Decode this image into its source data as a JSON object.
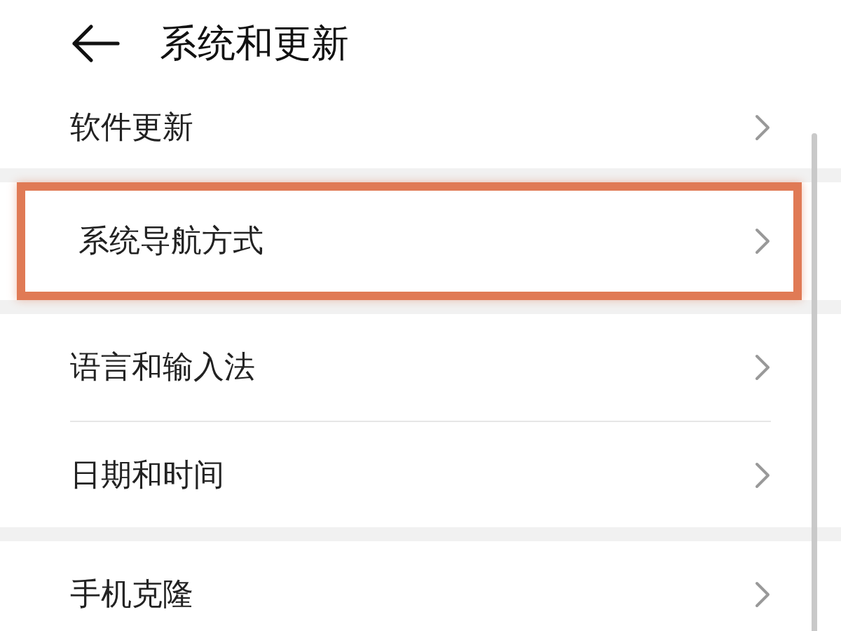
{
  "header": {
    "title": "系统和更新"
  },
  "groups": [
    {
      "items": [
        {
          "label": "软件更新",
          "highlighted": false
        }
      ]
    },
    {
      "items": [
        {
          "label": "系统导航方式",
          "highlighted": true
        }
      ]
    },
    {
      "items": [
        {
          "label": "语言和输入法",
          "highlighted": false
        },
        {
          "label": "日期和时间",
          "highlighted": false
        }
      ]
    },
    {
      "items": [
        {
          "label": "手机克隆",
          "highlighted": false
        }
      ]
    }
  ]
}
